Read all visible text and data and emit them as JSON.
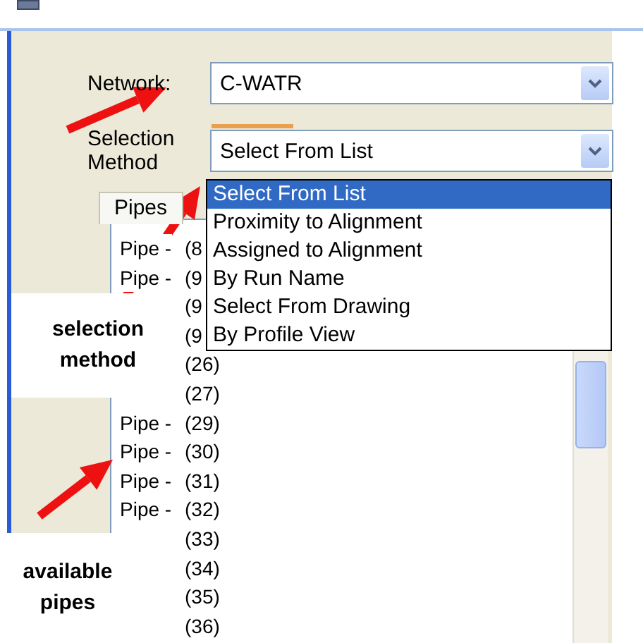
{
  "form": {
    "network_label": "Network:",
    "network_value": "C-WATR",
    "method_label": "Selection Method",
    "method_value": "Select From List"
  },
  "method_options": [
    {
      "label": "Select From List",
      "selected": true
    },
    {
      "label": "Proximity to Alignment",
      "selected": false
    },
    {
      "label": "Assigned to Alignment",
      "selected": false
    },
    {
      "label": "By Run Name",
      "selected": false
    },
    {
      "label": "Select From Drawing",
      "selected": false
    },
    {
      "label": "By Profile View",
      "selected": false
    }
  ],
  "pipes_tab": "Pipes",
  "pipes": [
    {
      "prefix": "Pipe -",
      "number": "(8"
    },
    {
      "prefix": "Pipe -",
      "number": "(9"
    },
    {
      "number": "(9"
    },
    {
      "number": "(9"
    },
    {
      "number": "(26)"
    },
    {
      "number": "(27)"
    },
    {
      "prefix": "Pipe -",
      "number": "(29)"
    },
    {
      "prefix": "Pipe -",
      "number": "(30)"
    },
    {
      "prefix": "Pipe -",
      "number": "(31)"
    },
    {
      "prefix": "Pipe -",
      "number": "(32)"
    },
    {
      "number": "(33)"
    },
    {
      "number": "(34)"
    },
    {
      "number": "(35)"
    },
    {
      "number": "(36)"
    }
  ],
  "callouts": [
    {
      "text": "selection method"
    },
    {
      "text": "available pipes"
    }
  ]
}
